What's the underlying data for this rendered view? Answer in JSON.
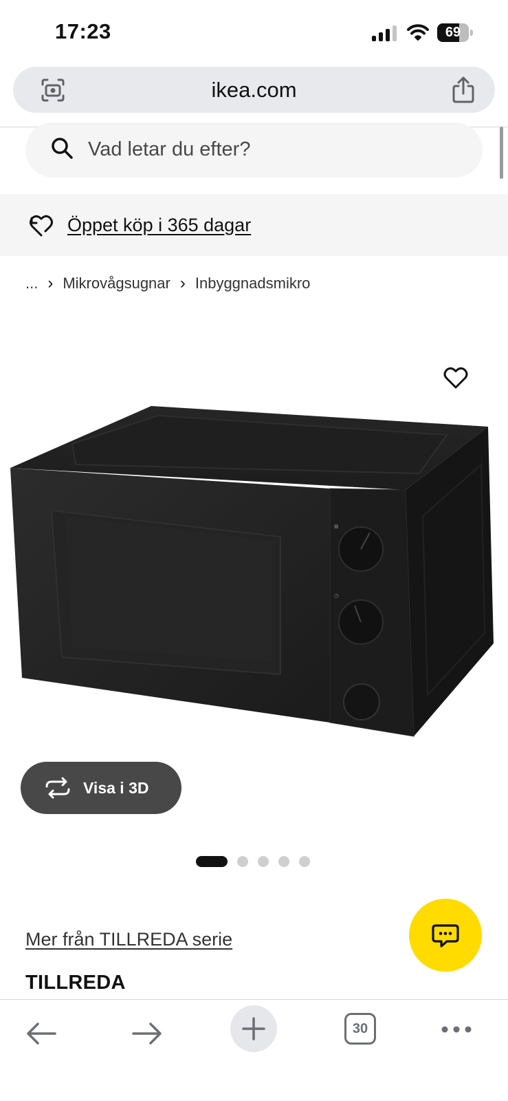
{
  "status_bar": {
    "time": "17:23",
    "battery_level": "69",
    "icons": [
      "signal-icon",
      "wifi-icon",
      "battery-icon"
    ]
  },
  "browser": {
    "url": "ikea.com",
    "icons": [
      "camera-scan-icon",
      "share-icon"
    ]
  },
  "search": {
    "placeholder": "Vad letar du efter?"
  },
  "promo": {
    "link_text": "Öppet köp i 365 dagar"
  },
  "breadcrumb": {
    "items": [
      "...",
      "Mikrovågsugnar",
      "Inbyggnadsmikro"
    ]
  },
  "gallery": {
    "view_3d_label": "Visa i 3D",
    "total_images": 5,
    "active_index": 0
  },
  "product": {
    "series_link": "Mer från TILLREDA serie",
    "name": "TILLREDA"
  },
  "toolbar": {
    "tab_count": "30"
  },
  "colors": {
    "chat_button": "#ffdb00",
    "view_3d_button": "#484848",
    "banner_background": "#f5f5f5"
  }
}
